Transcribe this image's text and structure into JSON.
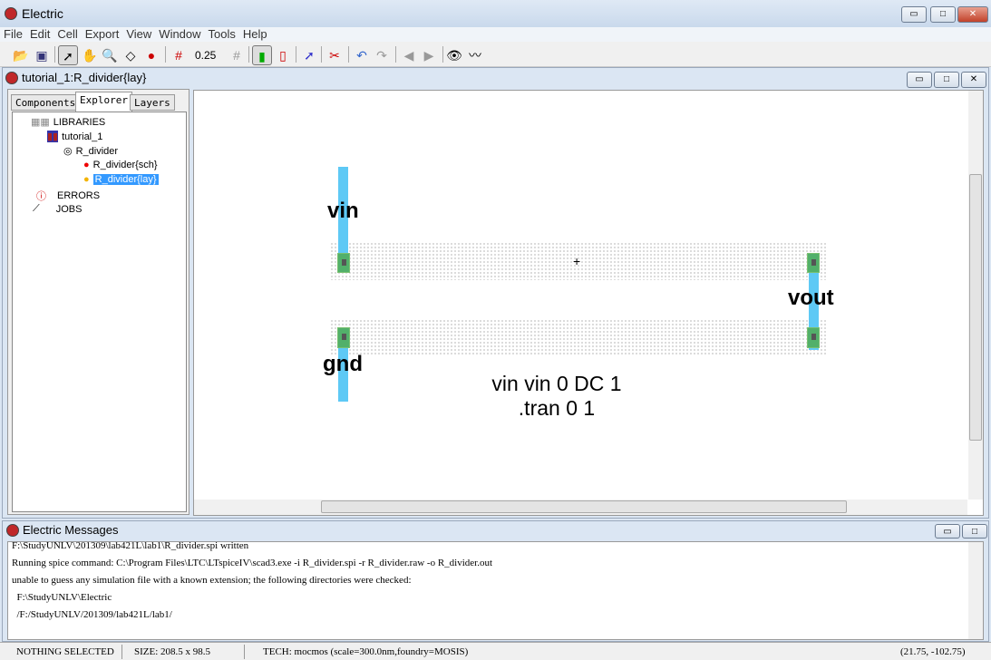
{
  "app": {
    "title": "Electric",
    "min": "▭",
    "max": "□",
    "close": "✕"
  },
  "menu": [
    "File",
    "Edit",
    "Cell",
    "Export",
    "View",
    "Window",
    "Tools",
    "Help"
  ],
  "toolbar": {
    "grid_value": "0.25"
  },
  "cell_window": {
    "title": "tutorial_1:R_divider{lay}"
  },
  "tabs": [
    "Components",
    "Explorer",
    "Layers"
  ],
  "tree": {
    "libraries": "LIBRARIES",
    "library": "tutorial_1",
    "cell": "R_divider",
    "views": [
      "R_divider{sch}",
      "R_divider{lay}"
    ],
    "errors": "ERRORS",
    "jobs": "JOBS"
  },
  "canvas": {
    "labels": {
      "vin": "vin",
      "vout": "vout",
      "gnd": "gnd"
    },
    "spice": [
      "vin vin 0 DC 1",
      ".tran 0 1"
    ],
    "colors": {
      "poly": "#5ec9f5",
      "contact": "#52b06a"
    }
  },
  "messages": {
    "title": "Electric Messages",
    "lines": [
      "F:\\StudyUNLV\\201309\\lab421L\\lab1\\R_divider.spi written",
      "Running spice command: C:\\Program Files\\LTC\\LTspiceIV\\scad3.exe -i R_divider.spi -r R_divider.raw -o R_divider.out",
      "unable to guess any simulation file with a known extension; the following directories were checked:",
      "  F:\\StudyUNLV\\Electric",
      "  /F:/StudyUNLV/201309/lab421L/lab1/"
    ]
  },
  "status": {
    "selection": "NOTHING SELECTED",
    "size": "SIZE: 208.5 x 98.5",
    "tech": "TECH: mocmos (scale=300.0nm,foundry=MOSIS)",
    "coords": "(21.75, -102.75)"
  }
}
